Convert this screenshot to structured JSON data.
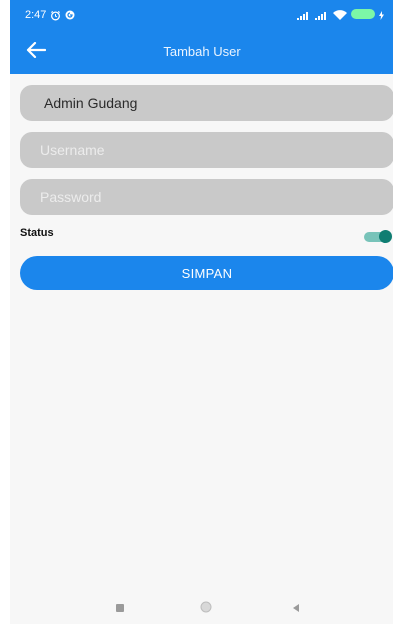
{
  "status_bar": {
    "time": "2:47"
  },
  "app_bar": {
    "title": "Tambah User"
  },
  "form": {
    "role_value": "Admin Gudang",
    "username_placeholder": "Username",
    "password_placeholder": "Password",
    "status_label": "Status",
    "status_enabled": true,
    "save_label": "SIMPAN"
  },
  "icons": {
    "back": "arrow-left-icon",
    "alarm": "alarm-icon",
    "google": "g-icon",
    "signal": "signal-icon",
    "wifi": "wifi-icon",
    "battery": "battery-icon"
  },
  "colors": {
    "primary": "#1b86ec",
    "field_bg": "#c9c9c9",
    "toggle_on": "#0f7d72"
  }
}
